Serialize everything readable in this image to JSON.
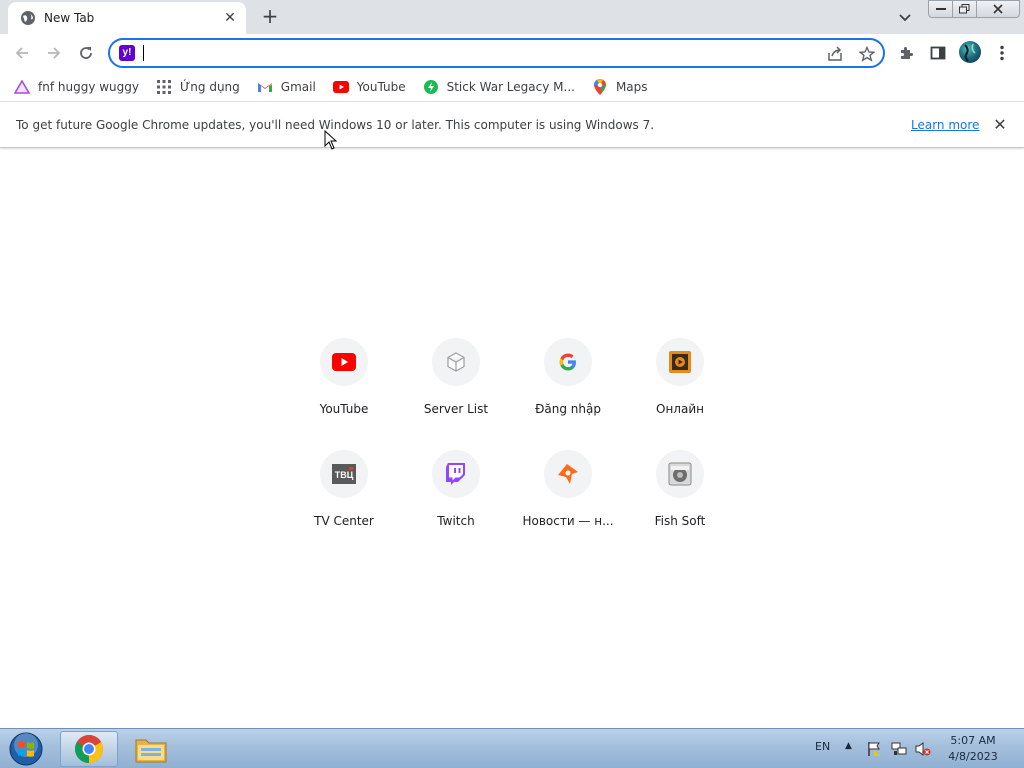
{
  "tab": {
    "title": "New Tab"
  },
  "omnibox": {
    "value": "",
    "placeholder": ""
  },
  "bookmarks": [
    {
      "label": "fnf huggy wuggy",
      "icon": "triangle-bookmark-icon"
    },
    {
      "label": "Ứng dụng",
      "icon": "apps-grid-icon"
    },
    {
      "label": "Gmail",
      "icon": "gmail-icon"
    },
    {
      "label": "YouTube",
      "icon": "youtube-icon"
    },
    {
      "label": "Stick War Legacy M...",
      "icon": "green-site-icon"
    },
    {
      "label": "Maps",
      "icon": "maps-icon"
    }
  ],
  "infobar": {
    "message": "To get future Google Chrome updates, you'll need Windows 10 or later. This computer is using Windows 7.",
    "link": "Learn more"
  },
  "shortcuts": [
    {
      "label": "YouTube",
      "icon": "youtube-icon"
    },
    {
      "label": "Server List",
      "icon": "cube-icon"
    },
    {
      "label": "Đăng nhập",
      "icon": "google-icon"
    },
    {
      "label": "Онлайн",
      "icon": "film-icon"
    },
    {
      "label": "TV Center",
      "icon": "tvc-icon"
    },
    {
      "label": "Twitch",
      "icon": "twitch-icon"
    },
    {
      "label": "Новости — н...",
      "icon": "news-pin-icon"
    },
    {
      "label": "Fish Soft",
      "icon": "fish-soft-icon"
    }
  ],
  "taskbar": {
    "language": "EN",
    "time": "5:07 AM",
    "date": "4/8/2023"
  },
  "colors": {
    "accent": "#1a73e8",
    "tabstrip": "#dee1e6",
    "yahoo": "#6001d2"
  }
}
